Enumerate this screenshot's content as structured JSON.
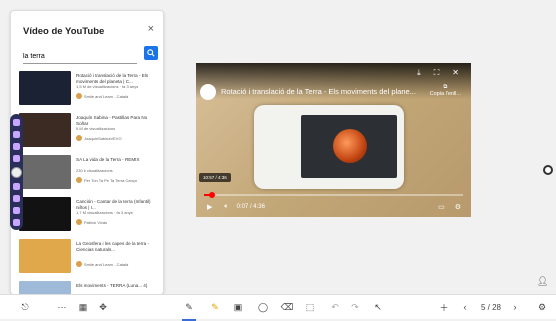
{
  "panel": {
    "title": "Vídeo de YouTube",
    "close": "×",
    "search_value": "la terra",
    "results": [
      {
        "title": "Rotació i translació de la Terra - Els moviments del planeta | C...",
        "meta": "1,5 M de visualitzacions · fa 3 anys",
        "channel": "Smile and Learn - Català",
        "thumb_color": "#1a2233"
      },
      {
        "title": "Joaquín Sabina - Pastillas Para No Soñar",
        "meta": "5 M de visualitzacions",
        "channel": "JoaquinSabinaVEVO",
        "thumb_color": "#3b2b22"
      },
      {
        "title": "SA La vida de la Terra - REMIX",
        "meta": "230 k visualitzacions",
        "channel": "Per Ton Ta Pe Ta Terra Canço",
        "thumb_color": "#6a6a6a"
      },
      {
        "title": "Canción - Cantar de la terra (Infantil) niños | I...",
        "meta": "1,7 M visualitzacions · fa 3 anys",
        "channel": "Patrick Vivás",
        "thumb_color": "#121212"
      },
      {
        "title": "La Geosfera i les capes de la terra - Ciencias naturals...",
        "meta": "",
        "channel": "Smile and Learn - Català",
        "thumb_color": "#e0a84a"
      },
      {
        "title": "Els moviments - TERRA (Luna... 4)",
        "meta": "",
        "channel": "",
        "thumb_color": "#9fb9d9"
      }
    ]
  },
  "player": {
    "title": "Rotació i translació de la Terra - Els moviments del plane...",
    "copy_label": "Copia l'enll...",
    "timestamp": "10:57 / 4:36",
    "time_display": "0:07 / 4:36",
    "progress_percent": 3
  },
  "bottombar": {
    "page_label": "5 / 28"
  },
  "colors": {
    "accent": "#1a73e8",
    "toolbar_bg": "#2a2f5a",
    "progress": "#ff0000"
  }
}
